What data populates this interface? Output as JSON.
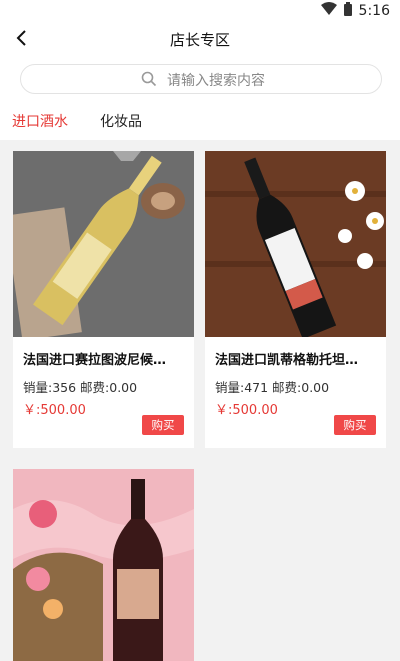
{
  "status_bar": {
    "time": "5:16"
  },
  "header": {
    "title": "店长专区"
  },
  "search": {
    "placeholder": "请输入搜索内容"
  },
  "tabs": [
    {
      "label": "进口酒水",
      "active": true
    },
    {
      "label": "化妆品",
      "active": false
    }
  ],
  "products": [
    {
      "name": "法国进口赛拉图波尼候…",
      "meta": "销量:356 邮费:0.00",
      "price": "￥:500.00",
      "buy": "购买"
    },
    {
      "name": "法国进口凯蒂格勒托坦…",
      "meta": "销量:471 邮费:0.00",
      "price": "￥:500.00",
      "buy": "购买"
    },
    {
      "name": "",
      "meta": "",
      "price": "",
      "buy": ""
    }
  ],
  "colors": {
    "accent": "#e53935",
    "buy": "#f04848"
  }
}
